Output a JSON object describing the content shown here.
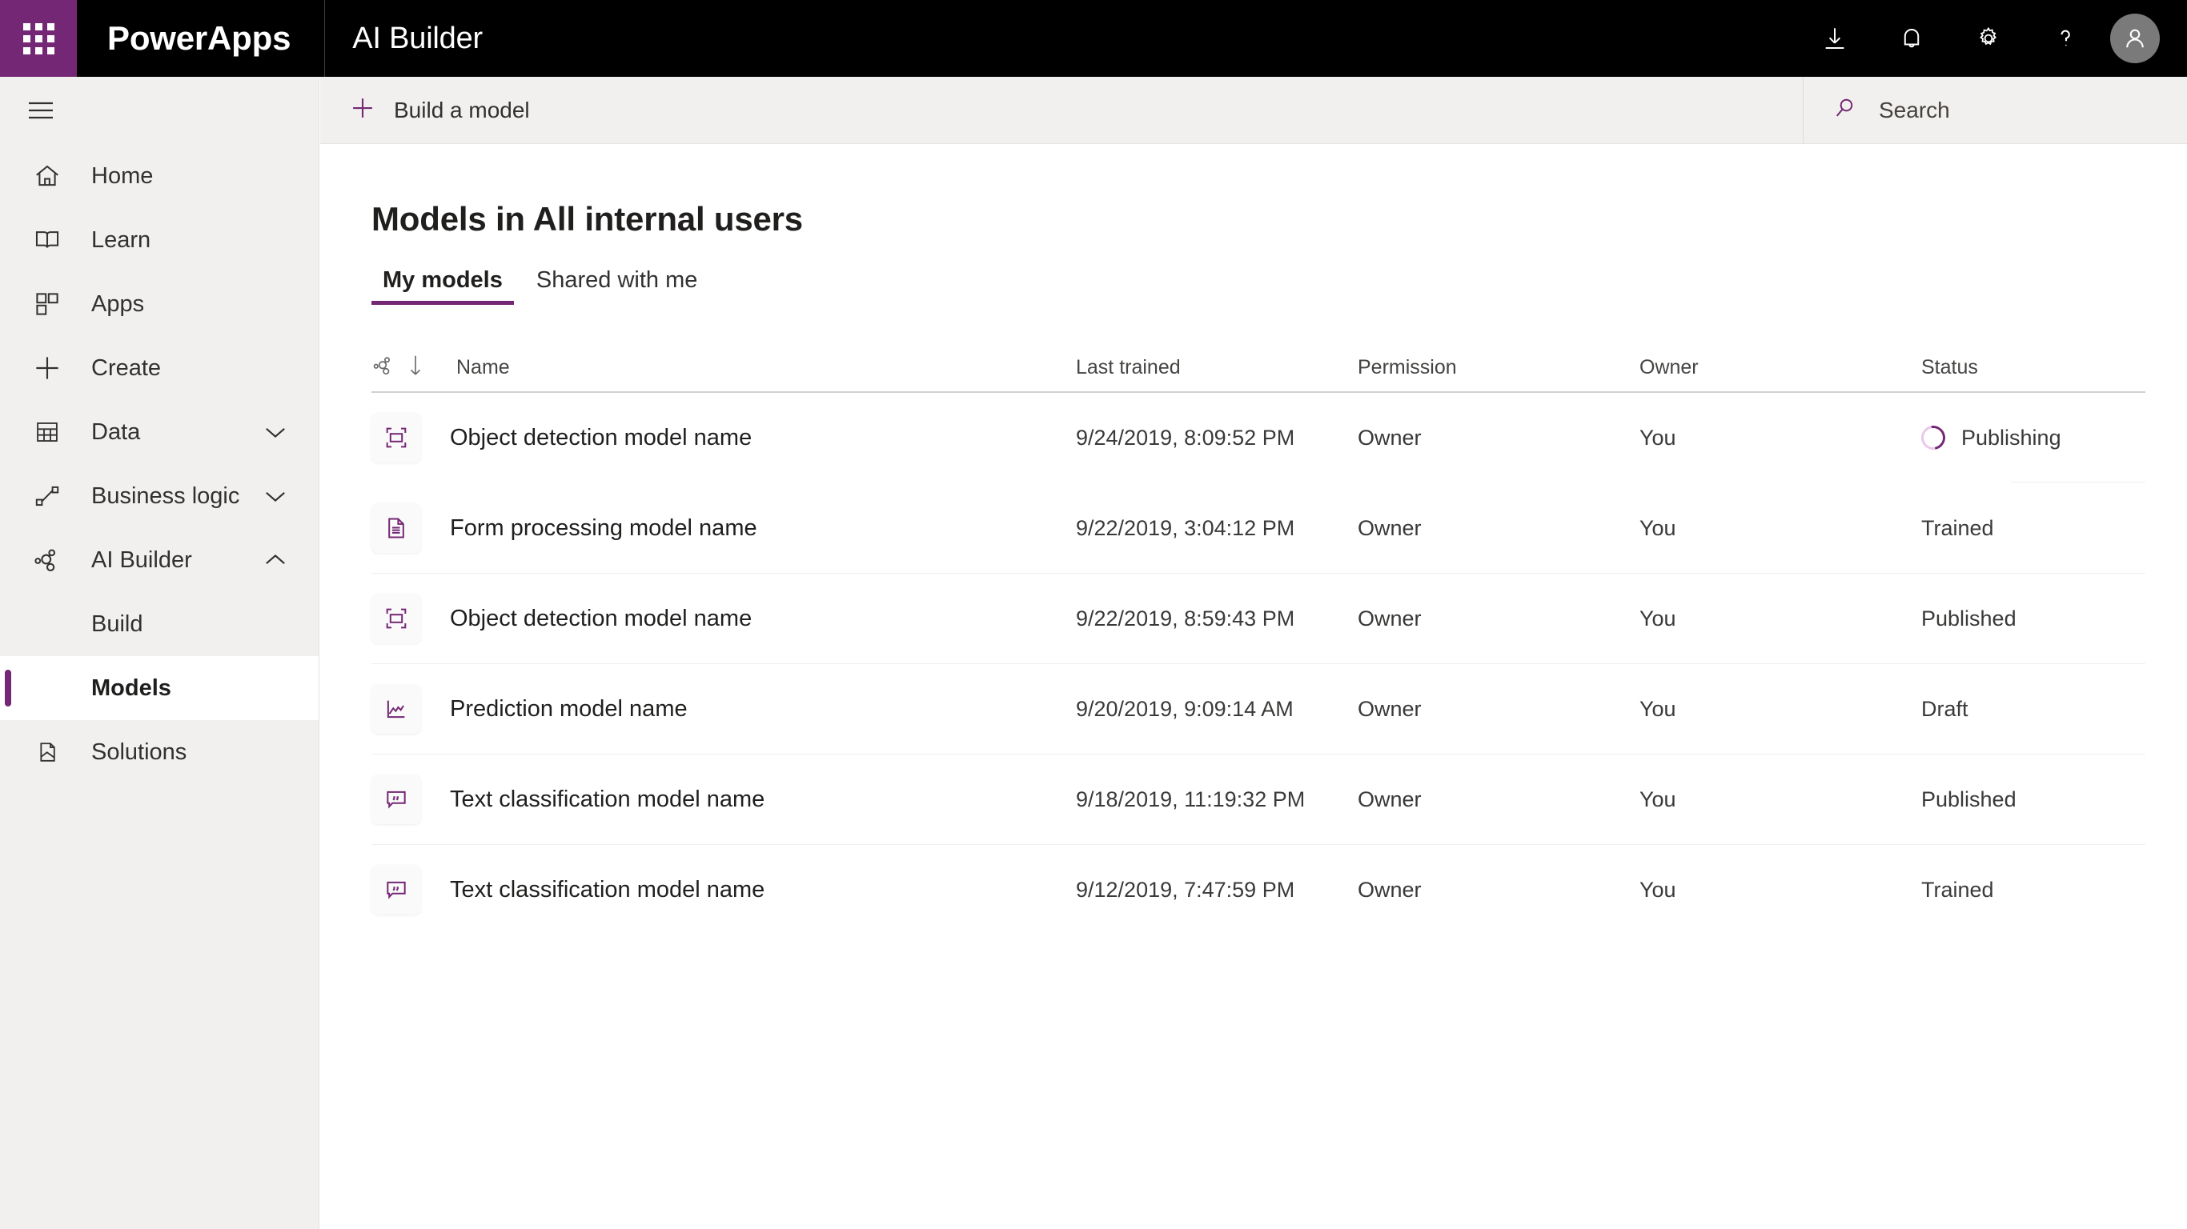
{
  "colors": {
    "brand_purple": "#742774",
    "topbar_bg": "#000000",
    "nav_bg": "#f2f0ee",
    "content_bg": "#ffffff"
  },
  "topbar": {
    "waffle_icon": "waffle-grid-icon",
    "brand": "PowerApps",
    "app_title": "AI Builder",
    "icons": [
      {
        "name": "download-icon",
        "label": "Download"
      },
      {
        "name": "notifications-bell-icon",
        "label": "Notifications"
      },
      {
        "name": "settings-gear-icon",
        "label": "Settings"
      },
      {
        "name": "help-question-icon",
        "label": "Help"
      }
    ],
    "avatar_icon": "user-avatar-icon"
  },
  "sidebar": {
    "hamburger_icon": "hamburger-menu-icon",
    "items": [
      {
        "label": "Home",
        "icon": "home-icon",
        "chevron": "",
        "selected": false
      },
      {
        "label": "Learn",
        "icon": "book-icon",
        "chevron": "",
        "selected": false
      },
      {
        "label": "Apps",
        "icon": "apps-grid-icon",
        "chevron": "",
        "selected": false
      },
      {
        "label": "Create",
        "icon": "plus-icon",
        "chevron": "",
        "selected": false
      },
      {
        "label": "Data",
        "icon": "table-icon",
        "chevron": "down",
        "selected": false
      },
      {
        "label": "Business logic",
        "icon": "flow-icon",
        "chevron": "down",
        "selected": false
      },
      {
        "label": "AI Builder",
        "icon": "ai-builder-icon",
        "chevron": "up",
        "selected": false
      }
    ],
    "subitems": [
      {
        "label": "Build",
        "selected": false
      },
      {
        "label": "Models",
        "selected": true
      }
    ],
    "trailing": [
      {
        "label": "Solutions",
        "icon": "solutions-icon",
        "chevron": "",
        "selected": false
      }
    ]
  },
  "commandbar": {
    "build_icon": "plus-icon",
    "build_label": "Build a model",
    "search_icon": "search-icon",
    "search_label": "Search",
    "search_value": ""
  },
  "main": {
    "page_title": "Models in All internal users",
    "tabs": [
      {
        "label": "My models",
        "active": true
      },
      {
        "label": "Shared with me",
        "active": false
      }
    ],
    "table": {
      "sort_icon": "ai-builder-icon",
      "sort_direction_icon": "arrow-down-icon",
      "columns": [
        "Name",
        "Last trained",
        "Permission",
        "Owner",
        "Status"
      ],
      "rows": [
        {
          "icon": "object-detection-icon",
          "name": "Object detection model name",
          "last_trained": "9/24/2019, 8:09:52 PM",
          "permission": "Owner",
          "owner": "You",
          "status": "Publishing",
          "status_spinner": true
        },
        {
          "icon": "form-processing-icon",
          "name": "Form processing model name",
          "last_trained": "9/22/2019, 3:04:12 PM",
          "permission": "Owner",
          "owner": "You",
          "status": "Trained",
          "status_spinner": false
        },
        {
          "icon": "object-detection-icon",
          "name": "Object detection model name",
          "last_trained": "9/22/2019, 8:59:43 PM",
          "permission": "Owner",
          "owner": "You",
          "status": "Published",
          "status_spinner": false
        },
        {
          "icon": "prediction-icon",
          "name": "Prediction model name",
          "last_trained": "9/20/2019, 9:09:14 AM",
          "permission": "Owner",
          "owner": "You",
          "status": "Draft",
          "status_spinner": false
        },
        {
          "icon": "text-classification-icon",
          "name": "Text classification model name",
          "last_trained": "9/18/2019, 11:19:32 PM",
          "permission": "Owner",
          "owner": "You",
          "status": "Published",
          "status_spinner": false
        },
        {
          "icon": "text-classification-icon",
          "name": "Text classification model name",
          "last_trained": "9/12/2019, 7:47:59 PM",
          "permission": "Owner",
          "owner": "You",
          "status": "Trained",
          "status_spinner": false
        }
      ]
    }
  }
}
